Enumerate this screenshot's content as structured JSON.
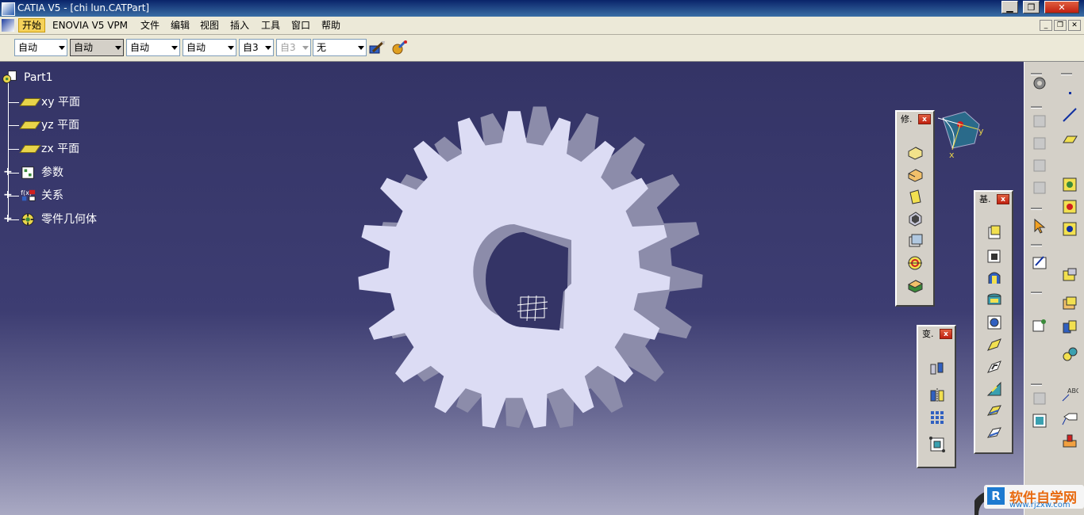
{
  "window": {
    "title": "CATIA V5 - [chi lun.CATPart]",
    "minimize": "▁",
    "restore": "❐",
    "close": "✕"
  },
  "menu": {
    "items": [
      "开始",
      "ENOVIA V5 VPM",
      "文件",
      "编辑",
      "视图",
      "插入",
      "工具",
      "窗口",
      "帮助"
    ],
    "active_index": 0
  },
  "toolbar": {
    "combos": [
      {
        "value": "自动"
      },
      {
        "value": "自动"
      },
      {
        "value": "自动"
      },
      {
        "value": "自动"
      },
      {
        "value": "自3"
      },
      {
        "value": "自3"
      },
      {
        "value": "无"
      }
    ],
    "icons": [
      "paintbrush-icon",
      "apply-material-icon"
    ]
  },
  "tree": {
    "root": "Part1",
    "nodes": [
      {
        "label": "xy 平面",
        "icon": "plane-icon"
      },
      {
        "label": "yz 平面",
        "icon": "plane-icon"
      },
      {
        "label": "zx 平面",
        "icon": "plane-icon"
      },
      {
        "label": "参数",
        "icon": "parameters-icon"
      },
      {
        "label": "关系",
        "icon": "relations-icon"
      },
      {
        "label": "零件几何体",
        "icon": "part-body-icon"
      }
    ]
  },
  "compass": {
    "x_label": "x",
    "y_label": "y"
  },
  "palettes": {
    "modify": {
      "title": "修.",
      "close": "x"
    },
    "basic": {
      "title": "基.",
      "close": "x"
    },
    "transform": {
      "title": "变.",
      "close": "x"
    }
  },
  "watermark": {
    "mark": "R",
    "text": "软件自学网",
    "url": "www.rjzxw.com"
  },
  "colors": {
    "viewport_top": "#343466",
    "viewport_bottom": "#a9a9c3",
    "gear_face": "#dcdcf4",
    "gear_side": "#8c8caa",
    "active_menu": "#f6d25a"
  }
}
